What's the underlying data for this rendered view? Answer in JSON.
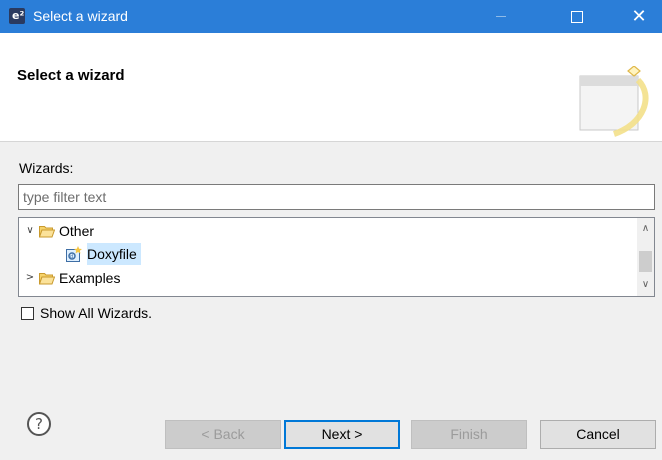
{
  "window": {
    "title": "Select a wizard",
    "app_icon_glyph": "e²",
    "controls": [
      "minimize-icon",
      "maximize-icon",
      "close-icon"
    ],
    "close_glyph": "✕"
  },
  "header": {
    "title": "Select a wizard"
  },
  "wizards": {
    "label": "Wizards:",
    "filter_placeholder": "type filter text",
    "filter_value": ""
  },
  "tree": {
    "items": [
      {
        "label": "Other",
        "expanded": true,
        "icon": "folder-open-icon",
        "twisty": "∨"
      },
      {
        "label": "Doxyfile",
        "selected": true,
        "icon": "doxyfile-icon"
      },
      {
        "label": "Examples",
        "expanded": false,
        "icon": "folder-open-icon",
        "twisty": ">"
      }
    ],
    "scroll_up": "∧",
    "scroll_down": "∨"
  },
  "options": {
    "show_all_label": "Show All Wizards.",
    "show_all_checked": false
  },
  "buttons": {
    "help": "?",
    "back": "< Back",
    "next": "Next >",
    "finish": "Finish",
    "cancel": "Cancel"
  },
  "colors": {
    "titlebar": "#2b7ed8",
    "selection": "#cce8ff",
    "default_button_border": "#0078d7"
  }
}
